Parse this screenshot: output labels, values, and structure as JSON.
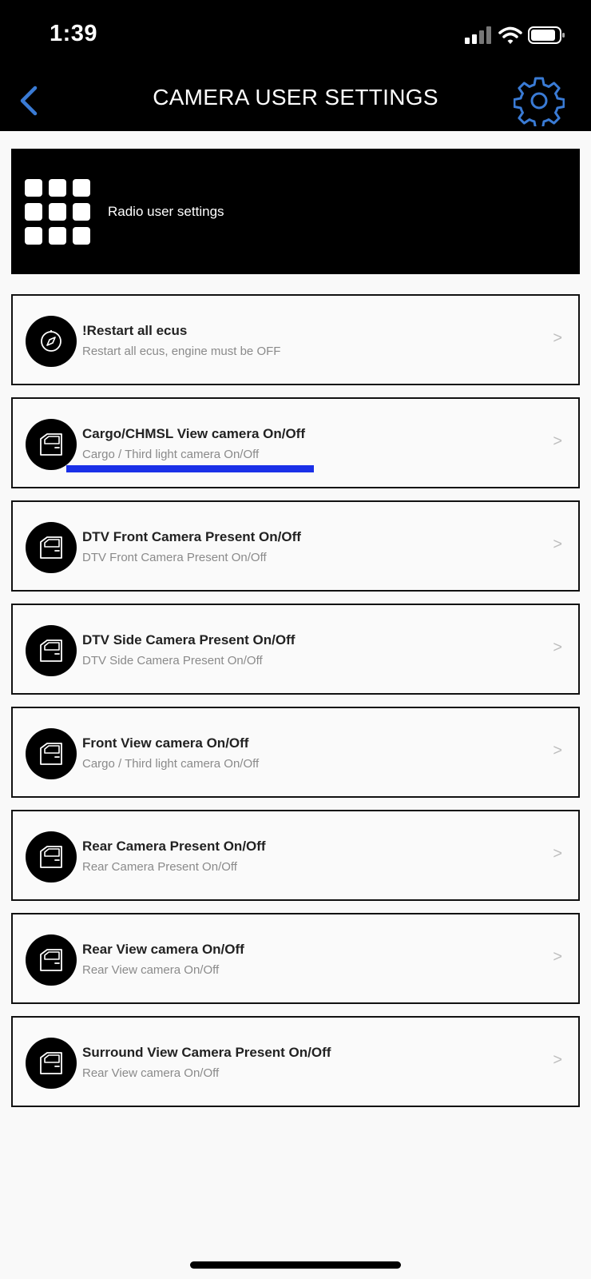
{
  "status_bar": {
    "time": "1:39"
  },
  "nav": {
    "title": "CAMERA USER SETTINGS"
  },
  "radio_tile": {
    "label": "Radio user settings"
  },
  "rows": [
    {
      "title": "!Restart all ecus",
      "subtitle": "Restart all ecus, engine must be OFF",
      "icon": "compass-icon",
      "chevron": ">"
    },
    {
      "title": "Cargo/CHMSL View camera On/Off",
      "subtitle": "Cargo / Third light camera On/Off",
      "icon": "car-door-icon",
      "chevron": ">"
    },
    {
      "title": "DTV Front Camera Present On/Off",
      "subtitle": "DTV Front Camera Present On/Off",
      "icon": "car-door-icon",
      "chevron": ">"
    },
    {
      "title": "DTV Side Camera Present On/Off",
      "subtitle": "DTV Side Camera Present On/Off",
      "icon": "car-door-icon",
      "chevron": ">"
    },
    {
      "title": "Front View camera On/Off",
      "subtitle": "Cargo / Third light camera On/Off",
      "icon": "car-door-icon",
      "chevron": ">"
    },
    {
      "title": "Rear Camera Present On/Off",
      "subtitle": "Rear Camera Present On/Off",
      "icon": "car-door-icon",
      "chevron": ">"
    },
    {
      "title": "Rear View camera On/Off",
      "subtitle": "Rear View camera On/Off",
      "icon": "car-door-icon",
      "chevron": ">"
    },
    {
      "title": "Surround View Camera Present On/Off",
      "subtitle": "Rear View camera On/Off",
      "icon": "car-door-icon",
      "chevron": ">"
    }
  ],
  "colors": {
    "accent": "#3a7bd5",
    "highlight": "#1a30e8",
    "header_background": "#000000"
  }
}
